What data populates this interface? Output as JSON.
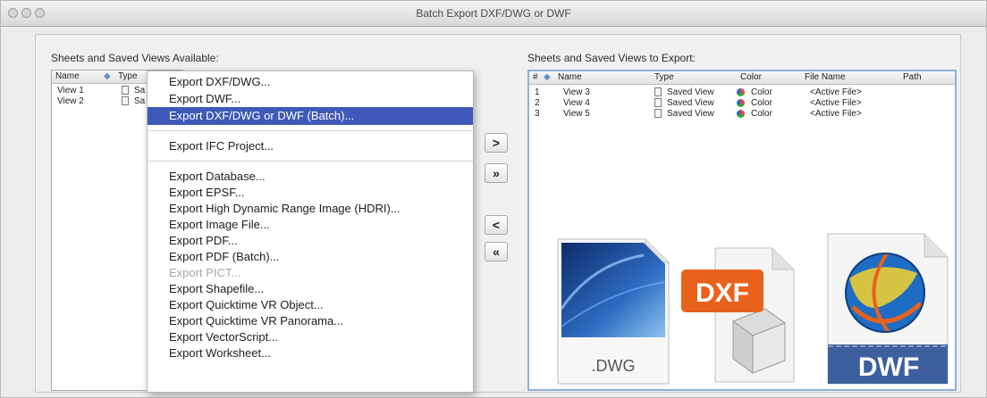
{
  "window": {
    "title": "Batch Export DXF/DWG or DWF"
  },
  "left": {
    "label": "Sheets and Saved Views Available:",
    "headers": {
      "name": "Name",
      "type": "Type"
    },
    "rows": [
      {
        "name": "View 1",
        "type": "Sa"
      },
      {
        "name": "View 2",
        "type": "Sa"
      }
    ]
  },
  "menu": {
    "items": [
      "Export DXF/DWG...",
      "Export DWF...",
      "Export DXF/DWG or DWF (Batch)...",
      "Export IFC Project...",
      "Export Database...",
      "Export EPSF...",
      "Export High Dynamic Range Image (HDRI)...",
      "Export Image File...",
      "Export PDF...",
      "Export PDF (Batch)...",
      "Export PICT...",
      "Export Shapefile...",
      "Export Quicktime VR Object...",
      "Export Quicktime VR Panorama...",
      "Export VectorScript...",
      "Export Worksheet..."
    ],
    "highlighted": "Export DXF/DWG or DWF (Batch)...",
    "disabled": "Export PICT..."
  },
  "buttons": {
    "add": ">",
    "add_all": "»",
    "remove": "<",
    "remove_all": "«"
  },
  "right": {
    "label": "Sheets and Saved Views to Export:",
    "headers": {
      "num": "#",
      "name": "Name",
      "type": "Type",
      "color": "Color",
      "file": "File Name",
      "path": "Path"
    },
    "rows": [
      {
        "num": "1",
        "name": "View 3",
        "type": "Saved View",
        "color": "Color",
        "file": "<Active File>"
      },
      {
        "num": "2",
        "name": "View 4",
        "type": "Saved View",
        "color": "Color",
        "file": "<Active File>"
      },
      {
        "num": "3",
        "name": "View 5",
        "type": "Saved View",
        "color": "Color",
        "file": "<Active File>"
      }
    ]
  },
  "icons": {
    "dwg_label": ".DWG",
    "dxf_label": "DXF",
    "dwf_label": "DWF"
  },
  "colors": {
    "highlight": "#3f59b8",
    "panel_border": "#8eb0dc",
    "dxf_orange": "#e8621c",
    "dwf_blue": "#3d5f9e"
  }
}
